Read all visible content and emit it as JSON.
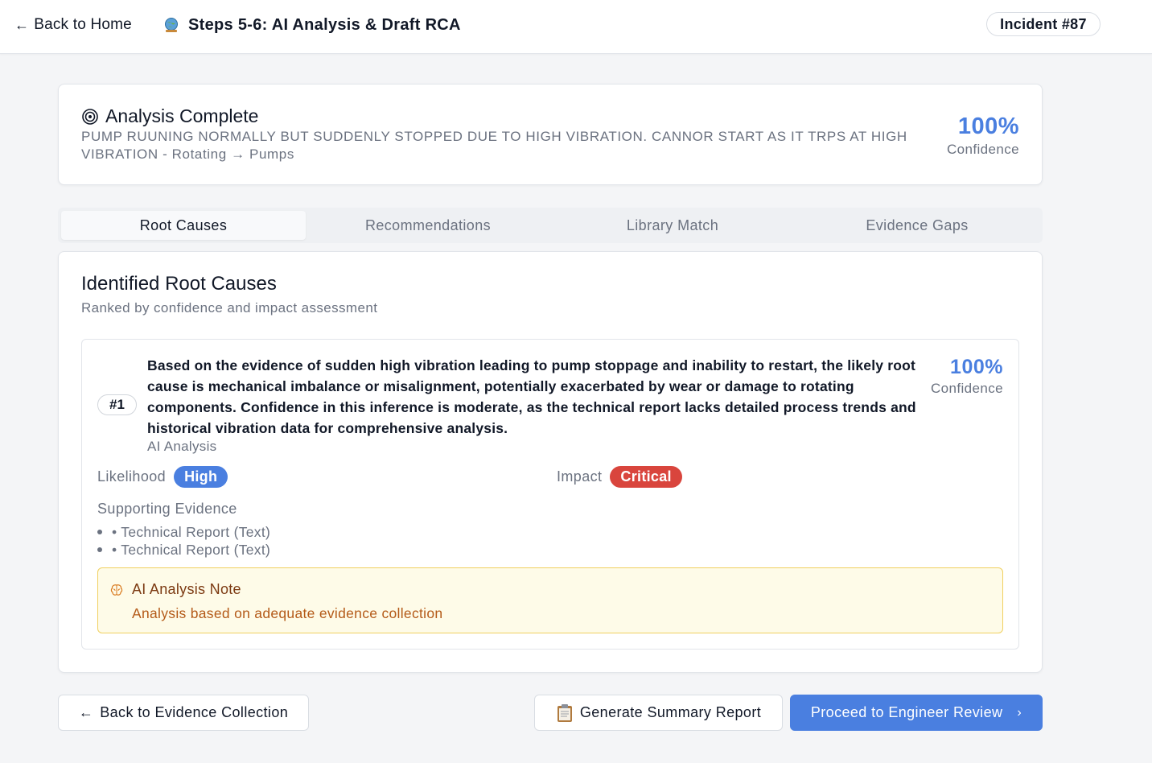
{
  "header": {
    "back_label": "Back to Home",
    "title": "Steps 5-6: AI Analysis & Draft RCA",
    "incident": "Incident #87"
  },
  "summary": {
    "heading": "Analysis Complete",
    "description": "PUMP RUUNING NORMALLY BUT SUDDENLY STOPPED DUE TO HIGH VIBRATION. CANNOR START AS IT TRPS AT HIGH VIBRATION - Rotating → Pumps",
    "confidence_value": "100%",
    "confidence_label": "Confidence"
  },
  "tabs": [
    {
      "label": "Root Causes",
      "active": true
    },
    {
      "label": "Recommendations",
      "active": false
    },
    {
      "label": "Library Match",
      "active": false
    },
    {
      "label": "Evidence Gaps",
      "active": false
    }
  ],
  "root_causes": {
    "title": "Identified Root Causes",
    "subtitle": "Ranked by confidence and impact assessment",
    "items": [
      {
        "rank": "#1",
        "text": "Based on the evidence of sudden high vibration leading to pump stoppage and inability to restart, the likely root cause is mechanical imbalance or misalignment, potentially exacerbated by wear or damage to rotating components. Confidence in this inference is moderate, as the technical report lacks detailed process trends and historical vibration data for comprehensive analysis.",
        "source": "AI Analysis",
        "confidence_value": "100%",
        "confidence_label": "Confidence",
        "likelihood_label": "Likelihood",
        "likelihood_value": "High",
        "impact_label": "Impact",
        "impact_value": "Critical",
        "evidence_title": "Supporting Evidence",
        "evidence": [
          "• Technical Report (Text)",
          "• Technical Report (Text)"
        ],
        "note_title": "AI Analysis Note",
        "note_text": "Analysis based on adequate evidence collection"
      }
    ]
  },
  "footer": {
    "back_label": "Back to Evidence Collection",
    "summary_label": "Generate Summary Report",
    "proceed_label": "Proceed to Engineer Review"
  },
  "colors": {
    "accent": "#4a7fe0",
    "critical": "#d9453d",
    "note_bg": "#fefbe8",
    "note_border": "#f0d060"
  }
}
